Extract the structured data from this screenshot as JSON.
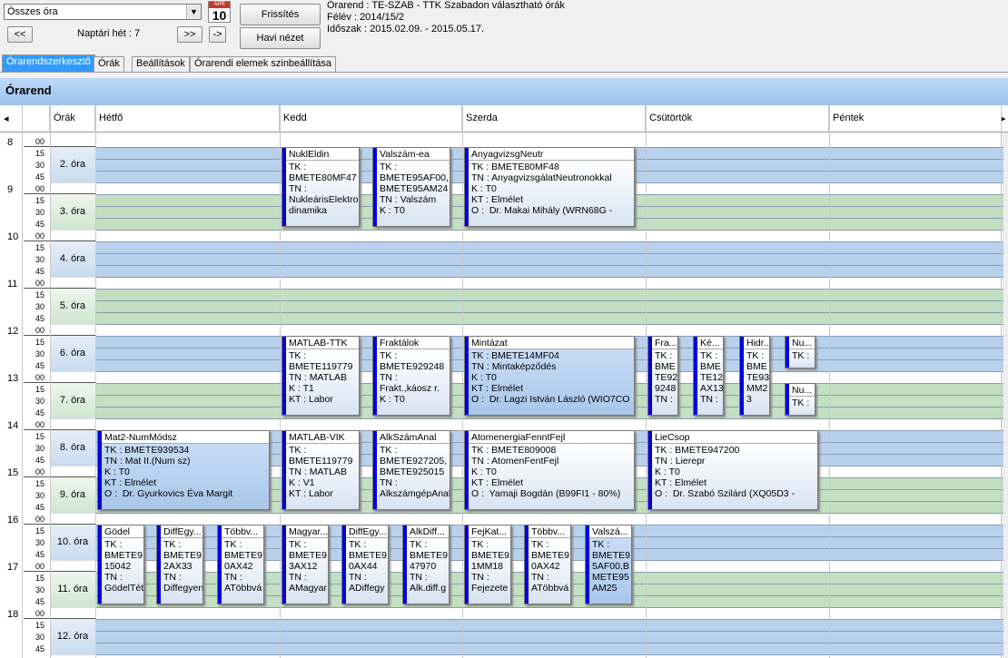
{
  "toolbar": {
    "combo_value": "Összes óra",
    "week_label": "Naptári hét : 7",
    "prev_label": "<<",
    "next_label": ">>",
    "goto_label": "->",
    "refresh_label": "Frissítés",
    "monthly_label": "Havi nézet",
    "calendar_month": "APR",
    "calendar_day": "10"
  },
  "info": {
    "line1": "Órarend : TE-SZAB - TTK Szabadon választható órák",
    "line2": "Félév : 2014/15/2",
    "line3": "Időszak : 2015.02.09. - 2015.05.17."
  },
  "tabs": [
    "Órarendszerkesztő",
    "Órák",
    "Beállítások",
    "Órarendi elemek szinbeállítása"
  ],
  "title": "Órarend",
  "columns": [
    "Órák",
    "Hétfő",
    "Kedd",
    "Szerda",
    "Csütörtök",
    "Péntek"
  ],
  "nav_left": "◂",
  "nav_right": "▸",
  "hours": [
    "8",
    "9",
    "10",
    "11",
    "12",
    "13",
    "14",
    "15",
    "16",
    "17",
    "18"
  ],
  "mins": [
    "00",
    "15",
    "30",
    "45"
  ],
  "orak": [
    "2. óra",
    "3. óra",
    "4. óra",
    "5. óra",
    "6. óra",
    "7. óra",
    "8. óra",
    "9. óra",
    "10. óra",
    "11. óra",
    "12. óra"
  ],
  "events": [
    {
      "title": "NuklEldin",
      "body": "TK :\nBMETE80MF47\nTN :\nNukleárisElektro\ndinamika"
    },
    {
      "title": "Valszám-ea",
      "body": "TK :\nBMETE95AF00,\nBMETE95AM24\nTN : Valszám\nK : T0"
    },
    {
      "title": "AnyagvizsgNeutr",
      "body": "TK : BMETE80MF48\nTN : AnyagvizsgálatNeutronokkal\nK : T0\nKT : Elmélet\nO :  Dr. Makai Mihály (WRN68G -"
    },
    {
      "title": "MATLAB-TTK",
      "body": "TK :\nBMETE119779\nTN : MATLAB\nK : T1\nKT : Labor"
    },
    {
      "title": "Fraktálok",
      "body": "TK :\nBMETE929248\nTN :\nFrakt.,káosz r.\nK : T0"
    },
    {
      "title": "Mintázat",
      "body": "TK : BMETE14MF04\nTN : Mintaképződés\nK : T0\nKT : Elmélet\nO :  Dr. Lagzi István László (WIO7CO"
    },
    {
      "title": "Fra...",
      "body": "TK :\nBME\nTE92\n9248\nTN :"
    },
    {
      "title": "Ké...",
      "body": "TK :\nBME\nTE12\nAX13\nTN :"
    },
    {
      "title": "Hidr...",
      "body": "TK :\nBME\nTE93\nMM2\n3"
    },
    {
      "title": "Nu...",
      "body": "TK :"
    },
    {
      "title": "Nu...",
      "body": "TK :"
    },
    {
      "title": "Mat2-NumMódsz",
      "body": "TK : BMETE939534\nTN : Mat II.(Num sz)\nK : T0\nKT : Elmélet\nO :  Dr. Gyurkovics Éva Margit"
    },
    {
      "title": "MATLAB-VIK",
      "body": "TK :\nBMETE119779\nTN : MATLAB\nK : V1\nKT : Labor"
    },
    {
      "title": "AlkSzámAnal",
      "body": "TK :\nBMETE927205,\nBMETE925015\nTN :\nAlkszámgépAnal"
    },
    {
      "title": "AtomenergiaFenntFejl",
      "body": "TK : BMETE809008\nTN : AtomenFentFejl\nK : T0\nKT : Elmélet\nO :  Yamaji Bogdán (B99FI1 - 80%)"
    },
    {
      "title": "LieCsop",
      "body": "TK : BMETE947200\nTN : Lierepr\nK : T0\nKT : Elmélet\nO :  Dr. Szabó Szilárd (XQ05D3 -"
    },
    {
      "title": "Gödel",
      "body": "TK :\nBMETE9\n15042\nTN :\nGödelTét"
    },
    {
      "title": "DiffEgy...",
      "body": "TK :\nBMETE9\n2AX33\nTN :\nDiffegyen"
    },
    {
      "title": "Többv...",
      "body": "TK :\nBMETE9\n0AX42\nTN :\nATöbbvá"
    },
    {
      "title": "Magyar...",
      "body": "TK :\nBMETE9\n3AX12\nTN :\nAMagyar"
    },
    {
      "title": "DiffEgy...",
      "body": "TK :\nBMETE9\n0AX44\nTN :\nADiffegy"
    },
    {
      "title": "AlkDiff...",
      "body": "TK :\nBMETE9\n47970\nTN :\nAlk.diff.g"
    },
    {
      "title": "FejKat...",
      "body": "TK :\nBMETE9\n1MM18\nTN :\nFejezete"
    },
    {
      "title": "Többv...",
      "body": "TK :\nBMETE9\n0AX42\nTN :\nATöbbvá"
    },
    {
      "title": "Valszá...",
      "body": "TK :\nBMETE9\n5AF00,B\nMETE95\nAM25"
    }
  ]
}
